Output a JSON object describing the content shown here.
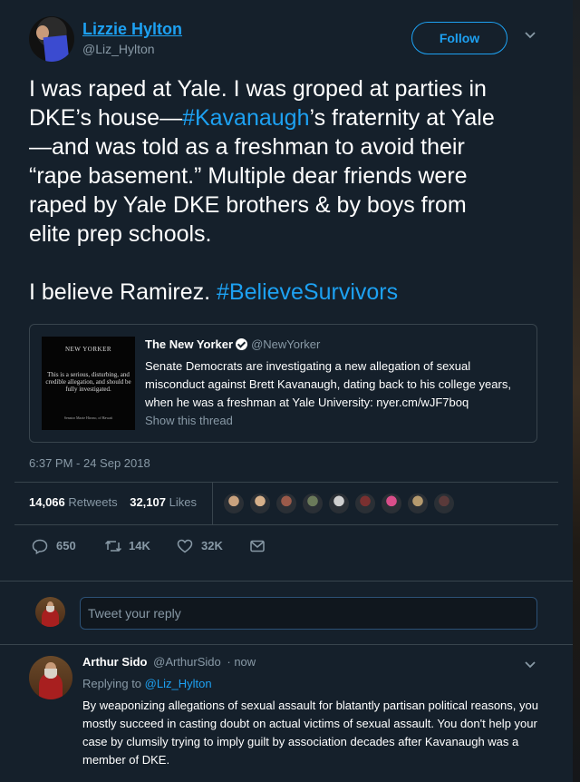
{
  "tweet": {
    "author_name": "Lizzie Hylton",
    "author_handle": "@Liz_Hylton",
    "follow_label": "Follow",
    "text_lines": [
      [
        {
          "t": "I was raped at Yale. I was groped at parties in"
        }
      ],
      [
        {
          "t": "DKE’s house—"
        },
        {
          "t": "#Kavanaugh",
          "tag": true
        },
        {
          "t": "’s fraternity at Yale"
        }
      ],
      [
        {
          "t": "—and was told as a freshman to avoid their"
        }
      ],
      [
        {
          "t": "“rape basement.” Multiple dear friends were"
        }
      ],
      [
        {
          "t": "raped by Yale DKE brothers & by boys from"
        }
      ],
      [
        {
          "t": "elite prep schools."
        }
      ],
      [
        {
          "t": ""
        }
      ],
      [
        {
          "t": "I believe Ramirez. "
        },
        {
          "t": "#BelieveSurvivors",
          "tag": true
        }
      ]
    ],
    "timestamp": "6:37 PM - 24 Sep 2018",
    "retweets_count": "14,066",
    "retweets_label": "Retweets",
    "likes_count": "32,107",
    "likes_label": "Likes",
    "replies_action_count": "650",
    "retweets_action_count": "14K",
    "likes_action_count": "32K"
  },
  "quoted": {
    "name": "The New Yorker",
    "handle": "@NewYorker",
    "body": "Senate Democrats are investigating a new allegation of sexual misconduct against Brett Kavanaugh, dating back to his college years, when he was a freshman at Yale University: nyer.cm/wJF7boq",
    "show_thread": "Show this thread",
    "thumb_brand": "NEW YORKER",
    "thumb_text": "This is a serious, disturbing, and credible allegation, and should be fully investigated.",
    "thumb_source": "Senator Mazie Hirono, of Hawaii"
  },
  "liker_colors": [
    "#c9a27e",
    "#d6b08a",
    "#9a5a4a",
    "#6b7a5a",
    "#cfcfcf",
    "#7a3030",
    "#d94e8a",
    "#b59a6e",
    "#5a3a3a"
  ],
  "reply_box": {
    "placeholder": "Tweet your reply"
  },
  "comment": {
    "name": "Arthur Sido",
    "handle": "@ArthurSido",
    "time": "· now",
    "replying_prefix": "Replying to",
    "replying_to": "@Liz_Hylton",
    "body": "By weaponizing allegations of sexual assault for blatantly partisan political reasons, you mostly succeed in casting doubt on actual victims of sexual assault. You don't help your case by clumsily trying to imply guilt by association decades after Kavanaugh was a member of DKE."
  },
  "colors": {
    "accent": "#1da1f2",
    "background": "#15202b",
    "muted": "#8899a6",
    "border": "#38444d"
  }
}
